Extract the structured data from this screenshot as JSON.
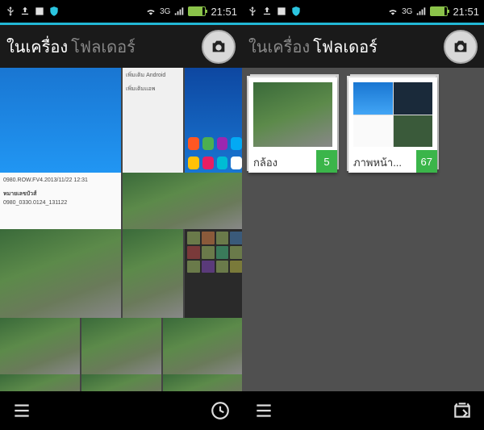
{
  "status": {
    "signal_text": "3G",
    "time": "21:51"
  },
  "header": {
    "tab_device": "ในเครื่อง",
    "tab_folder": "โฟลเดอร์"
  },
  "left_screen": {
    "active_tab": "device",
    "text_thumb_line1": "0980.ROW.FV4.2013/11/22 12:31",
    "text_thumb_line2": "หมายเลขบัวส์",
    "text_thumb_line3": "0980_0330.0124_131122"
  },
  "right_screen": {
    "active_tab": "folder",
    "folders": [
      {
        "name": "กล้อง",
        "count": 5
      },
      {
        "name": "ภาพหน้า...",
        "count": 67
      }
    ]
  }
}
